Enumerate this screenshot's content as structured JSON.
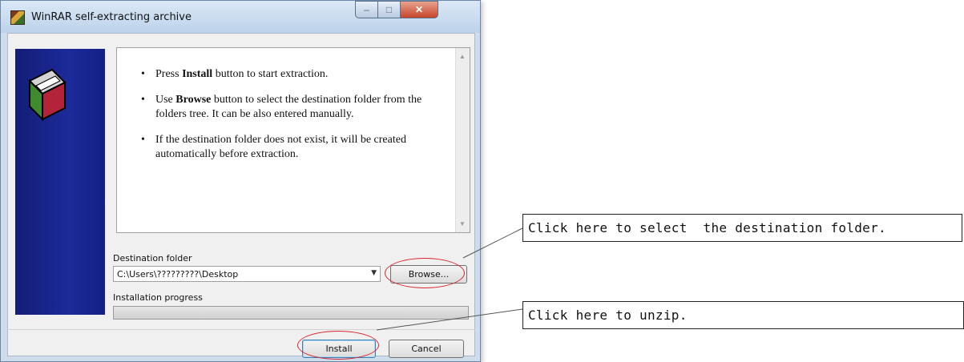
{
  "window": {
    "title": "WinRAR self-extracting archive",
    "controls": {
      "minimize": "–",
      "maximize": "□",
      "close": "✕"
    }
  },
  "info": {
    "items": [
      {
        "prefix": "Press ",
        "bold": "Install",
        "suffix": " button to start extraction."
      },
      {
        "prefix": "Use ",
        "bold": "Browse",
        "suffix": " button to select the destination folder from the folders tree. It can be also entered manually."
      },
      {
        "prefix": "",
        "bold": "",
        "suffix": "If the destination folder does not exist, it will be created automatically before extraction."
      }
    ]
  },
  "destination": {
    "label": "Destination folder",
    "value": "C:\\Users\\?????????\\Desktop",
    "browse_label": "Browse..."
  },
  "progress": {
    "label": "Installation progress",
    "value": 0
  },
  "buttons": {
    "install": "Install",
    "cancel": "Cancel"
  },
  "annotations": {
    "browse_callout": "Click here to select  the destination folder.",
    "install_callout": "Click here to unzip."
  },
  "colors": {
    "sidebar": "#1a2690",
    "highlight_ellipse": "#d8262f"
  },
  "icons": [
    "winrar-app-icon",
    "winrar-logo-icon",
    "minimize-icon",
    "maximize-icon",
    "close-icon",
    "scroll-up-icon",
    "scroll-down-icon",
    "dropdown-arrow-icon"
  ]
}
